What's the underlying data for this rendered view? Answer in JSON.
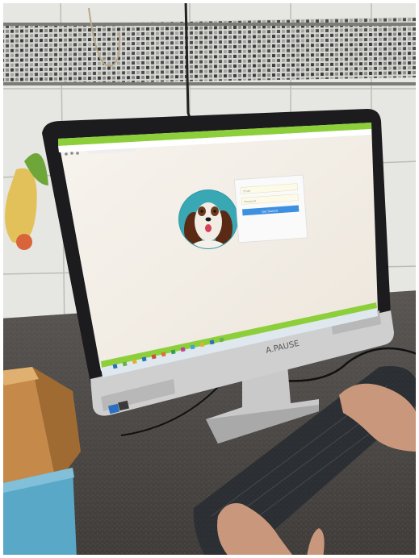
{
  "photo": {
    "subject": "all-in-one desktop monitor",
    "colors": {
      "wall_tile": "#e6e6e2",
      "mosaic_dark": "#3a3a3a",
      "counter": "#4b4845",
      "monitor_frame": "#1c1c1e",
      "monitor_stand": "#c9c9c9",
      "screen_bg": "#f2ede6",
      "accent_green": "#8ccf3a",
      "keyboard": "#2b2e33",
      "skin": "#c9987c",
      "cardboard": "#c58a4a",
      "blue_box": "#5aa8c8"
    }
  },
  "browser": {
    "tab_title": "",
    "address_text": ""
  },
  "login_card": {
    "field1_placeholder": "Email",
    "field2_placeholder": "Password",
    "button_label": "Get Started",
    "footer_link": ""
  },
  "monitor": {
    "brand_text": "A.PAUSE"
  }
}
